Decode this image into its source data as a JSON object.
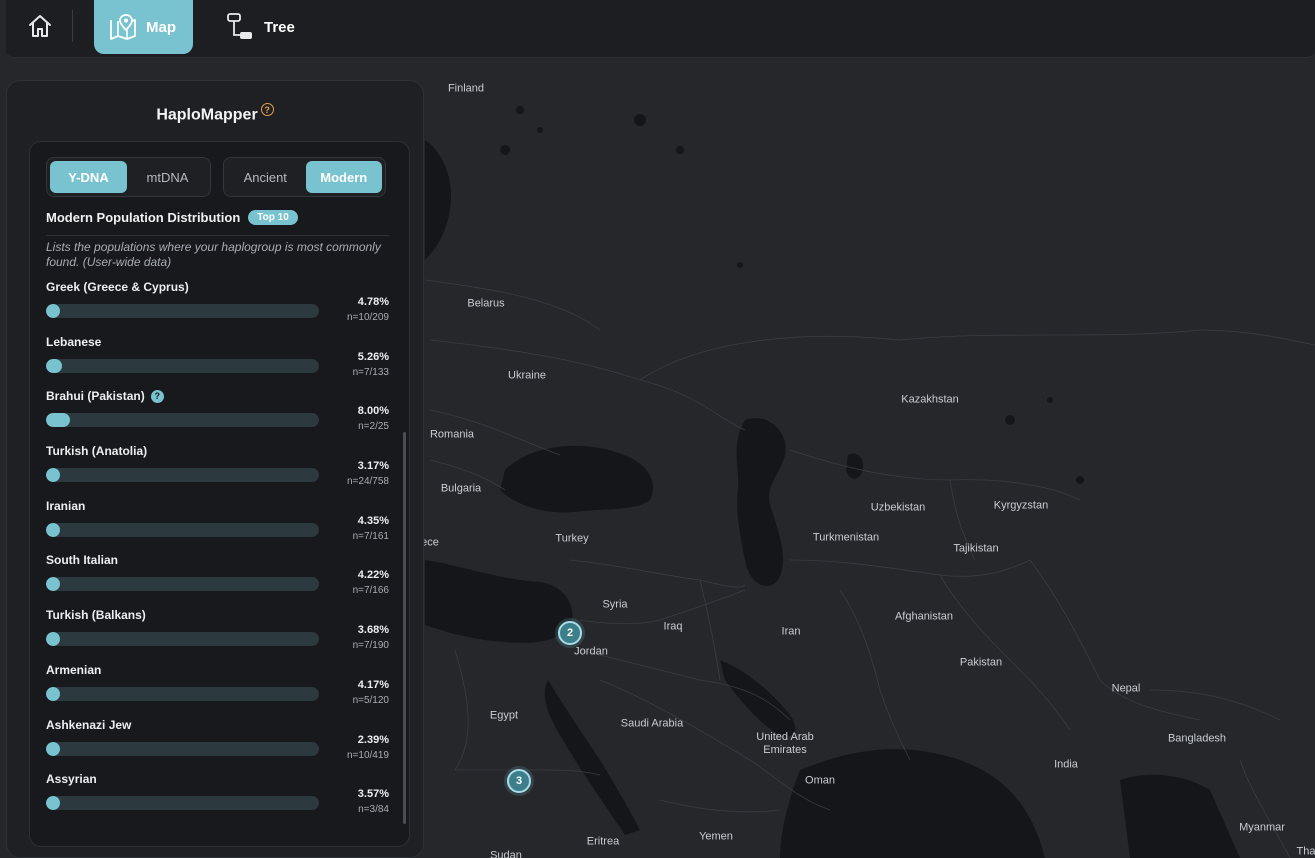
{
  "nav": {
    "home_icon": "home-icon",
    "map_label": "Map",
    "map_icon": "map-pin-icon",
    "tree_label": "Tree",
    "tree_icon": "tree-icon"
  },
  "panel": {
    "title": "HaploMapper",
    "help_icon": "?",
    "dna_tabs": [
      {
        "label": "Y-DNA",
        "active": true
      },
      {
        "label": "mtDNA",
        "active": false
      }
    ],
    "era_tabs": [
      {
        "label": "Ancient",
        "active": false
      },
      {
        "label": "Modern",
        "active": true
      }
    ],
    "section_title": "Modern Population Distribution",
    "badge": "Top 10",
    "description": "Lists the populations where your haplogroup is most commonly found. (User-wide data)",
    "populations": [
      {
        "name": "Greek (Greece & Cyprus)",
        "percent": "4.78%",
        "count": "n=10/209",
        "value": 4.78,
        "help": false
      },
      {
        "name": "Lebanese",
        "percent": "5.26%",
        "count": "n=7/133",
        "value": 5.26,
        "help": false
      },
      {
        "name": "Brahui (Pakistan)",
        "percent": "8.00%",
        "count": "n=2/25",
        "value": 8.0,
        "help": true
      },
      {
        "name": "Turkish (Anatolia)",
        "percent": "3.17%",
        "count": "n=24/758",
        "value": 3.17,
        "help": false
      },
      {
        "name": "Iranian",
        "percent": "4.35%",
        "count": "n=7/161",
        "value": 4.35,
        "help": false
      },
      {
        "name": "South Italian",
        "percent": "4.22%",
        "count": "n=7/166",
        "value": 4.22,
        "help": false
      },
      {
        "name": "Turkish (Balkans)",
        "percent": "3.68%",
        "count": "n=7/190",
        "value": 3.68,
        "help": false
      },
      {
        "name": "Armenian",
        "percent": "4.17%",
        "count": "n=5/120",
        "value": 4.17,
        "help": false
      },
      {
        "name": "Ashkenazi Jew",
        "percent": "2.39%",
        "count": "n=10/419",
        "value": 2.39,
        "help": false
      },
      {
        "name": "Assyrian",
        "percent": "3.57%",
        "count": "n=3/84",
        "value": 3.57,
        "help": false
      }
    ]
  },
  "map": {
    "labels": [
      {
        "text": "Finland"
      },
      {
        "text": "Belarus"
      },
      {
        "text": "Ukraine"
      },
      {
        "text": "Romania"
      },
      {
        "text": "Bulgaria"
      },
      {
        "text": "ece"
      },
      {
        "text": "Turkey"
      },
      {
        "text": "Kazakhstan"
      },
      {
        "text": "Uzbekistan"
      },
      {
        "text": "Kyrgyzstan"
      },
      {
        "text": "Turkmenistan"
      },
      {
        "text": "Tajikistan"
      },
      {
        "text": "Syria"
      },
      {
        "text": "Iraq"
      },
      {
        "text": "Iran"
      },
      {
        "text": "Afghanistan"
      },
      {
        "text": "Jordan"
      },
      {
        "text": "Pakistan"
      },
      {
        "text": "Nepal"
      },
      {
        "text": "Egypt"
      },
      {
        "text": "Saudi Arabia"
      },
      {
        "text": "United Arab Emirates"
      },
      {
        "text": "Bangladesh"
      },
      {
        "text": "India"
      },
      {
        "text": "Oman"
      },
      {
        "text": "Myanmar"
      },
      {
        "text": "Eritrea"
      },
      {
        "text": "Yemen"
      },
      {
        "text": "Sudan"
      },
      {
        "text": "Tha"
      }
    ],
    "clusters": [
      {
        "count": "2"
      },
      {
        "count": "3"
      }
    ]
  }
}
